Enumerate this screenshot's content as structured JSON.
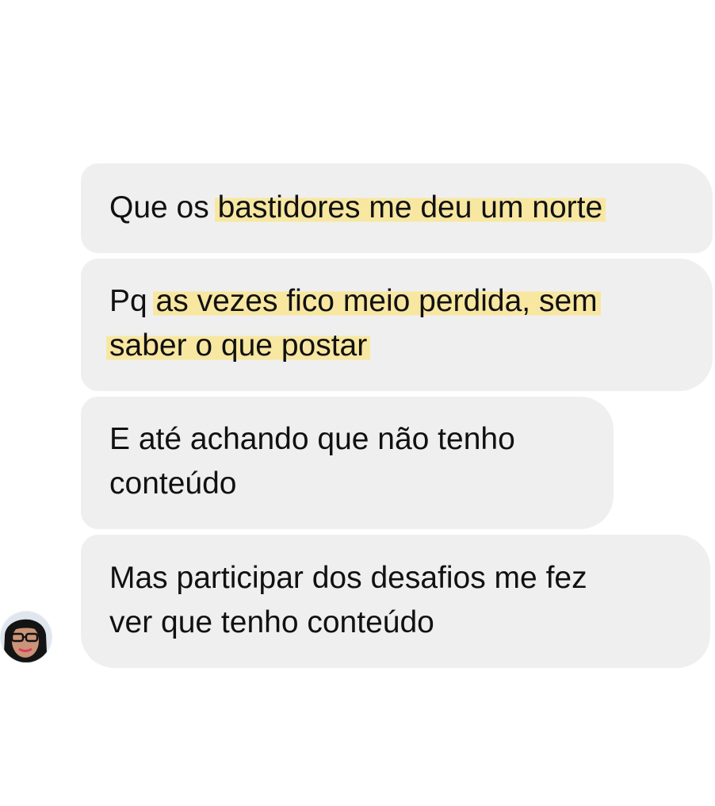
{
  "messages": [
    {
      "lines": [
        {
          "plain": "Que os ",
          "highlight": "bastidores me deu um norte"
        }
      ]
    },
    {
      "lines": [
        {
          "plain": "Pq ",
          "highlight": "as vezes fico meio perdida, sem"
        },
        {
          "plain": "",
          "highlight": "saber o que postar"
        }
      ]
    },
    {
      "lines": [
        {
          "plain": "E até achando que não tenho"
        },
        {
          "plain": "conteúdo"
        }
      ]
    },
    {
      "lines": [
        {
          "plain": "Mas participar dos desafios me fez"
        },
        {
          "plain": "ver que tenho conteúdo"
        }
      ]
    }
  ],
  "sender": {
    "avatar_icon": "profile-photo"
  },
  "colors": {
    "bubble_background": "#efefef",
    "highlight": "#f8e7a1",
    "text": "#111111",
    "page_background": "#ffffff"
  }
}
